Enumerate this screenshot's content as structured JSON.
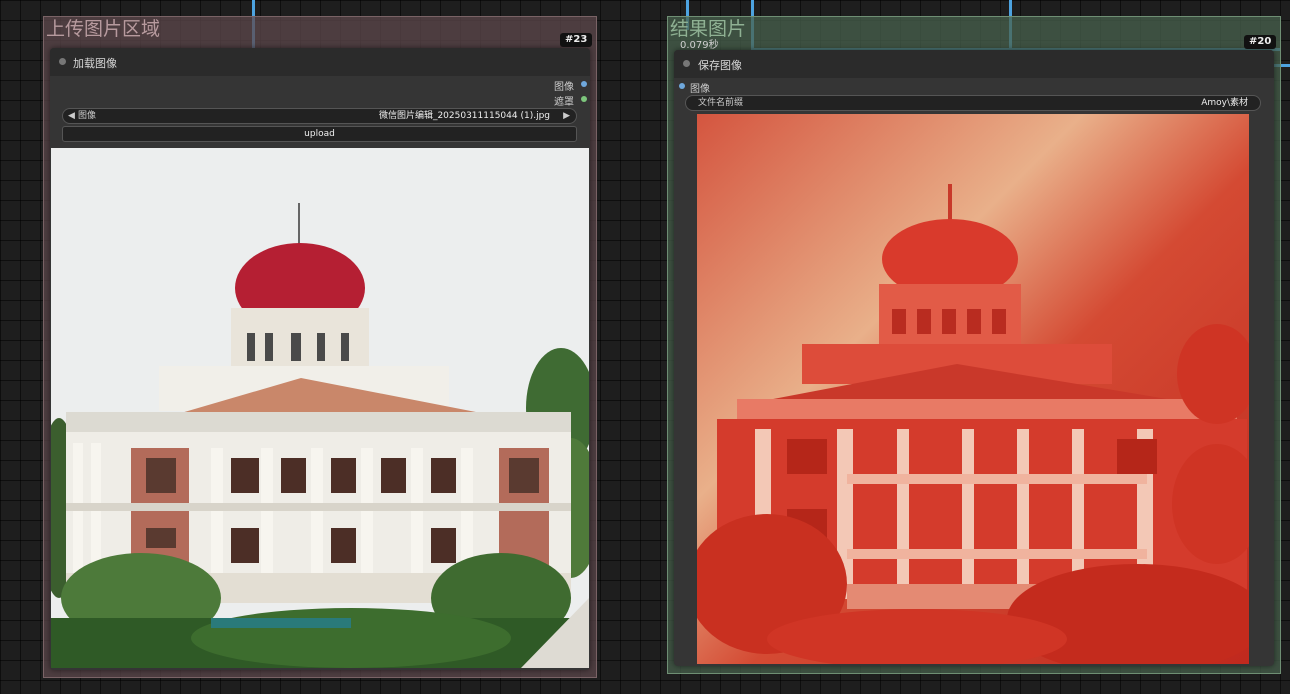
{
  "left_group": {
    "title": "上传图片区域",
    "node": {
      "title": "加载图像",
      "badge": "#23",
      "outputs": [
        "图像",
        "遮罩"
      ],
      "image_widget": {
        "label": "图像",
        "value": "微信图片编辑_20250311115044 (1).jpg",
        "prev_icon": "◀",
        "next_icon": "▶"
      },
      "upload_button": "upload"
    }
  },
  "right_group": {
    "title": "结果图片",
    "node": {
      "title": "保存图像",
      "badge": "#20",
      "timing": "0.079秒",
      "input": "图像",
      "prefix_widget": {
        "label": "文件名前缀",
        "value": "Amoy\\素材"
      }
    }
  },
  "colors": {
    "left_group_bg": "#4a3b3d",
    "right_group_bg": "#3b5040",
    "wire": "#4da3e0",
    "output_image_port": "#6fa8dc",
    "output_mask_port": "#7dc77d"
  },
  "icons": [
    "collapse-dot-icon",
    "prev-arrow-icon",
    "next-arrow-icon"
  ]
}
